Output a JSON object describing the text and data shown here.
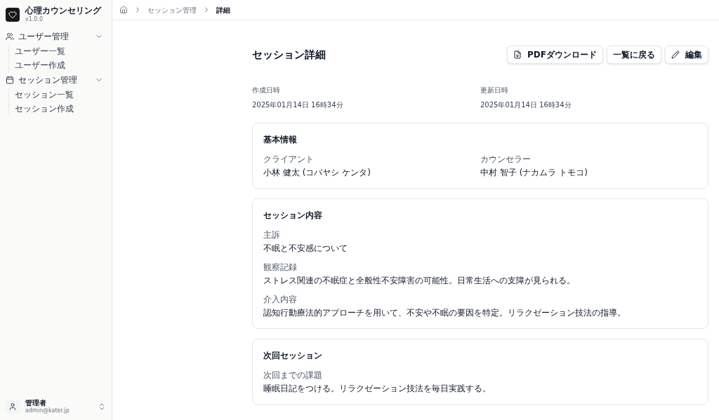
{
  "app": {
    "name": "心理カウンセリング",
    "version": "v1.0.0"
  },
  "sidebar": {
    "groups": [
      {
        "label": "ユーザー管理",
        "kind": "users",
        "expanded": true,
        "children": [
          {
            "label": "ユーザー一覧"
          },
          {
            "label": "ユーザー作成"
          }
        ]
      },
      {
        "label": "セッション管理",
        "kind": "calendar",
        "expanded": true,
        "children": [
          {
            "label": "セッション一覧"
          },
          {
            "label": "セッション作成"
          }
        ]
      }
    ],
    "user": {
      "name": "管理者",
      "email": "admin@kater.jp"
    }
  },
  "breadcrumb": [
    {
      "label": "セッション管理",
      "selected": false
    },
    {
      "label": "詳細",
      "selected": true
    }
  ],
  "page": {
    "title": "セッション詳細",
    "buttons": [
      {
        "label": "PDFダウンロード",
        "kind": "pdf"
      },
      {
        "label": "一覧に戻る",
        "kind": "back"
      },
      {
        "label": "編集",
        "kind": "edit"
      }
    ],
    "meta": [
      {
        "label": "作成日時",
        "value": "2025年01月14日 16時34分"
      },
      {
        "label": "更新日時",
        "value": "2025年01月14日 16時34分"
      }
    ],
    "cards": [
      {
        "title": "基本情報",
        "kind": "grid",
        "fields": [
          {
            "label": "クライアント",
            "value": "小林 健太 (コバヤシ ケンタ)"
          },
          {
            "label": "カウンセラー",
            "value": "中村 智子 (ナカムラ トモコ)"
          }
        ]
      },
      {
        "title": "セッション内容",
        "kind": "stack",
        "fields": [
          {
            "label": "主訴",
            "value": "不眠と不安感について"
          },
          {
            "label": "観察記録",
            "value": "ストレス関連の不眠症と全般性不安障害の可能性。日常生活への支障が見られる。"
          },
          {
            "label": "介入内容",
            "value": "認知行動療法的アプローチを用いて、不安や不眠の要因を特定。リラクゼーション技法の指導。"
          }
        ]
      },
      {
        "title": "次回セッション",
        "kind": "stack",
        "fields": [
          {
            "label": "次回までの課題",
            "value": "睡眠日記をつける。リラクゼーション技法を毎日実践する。"
          }
        ]
      }
    ]
  }
}
